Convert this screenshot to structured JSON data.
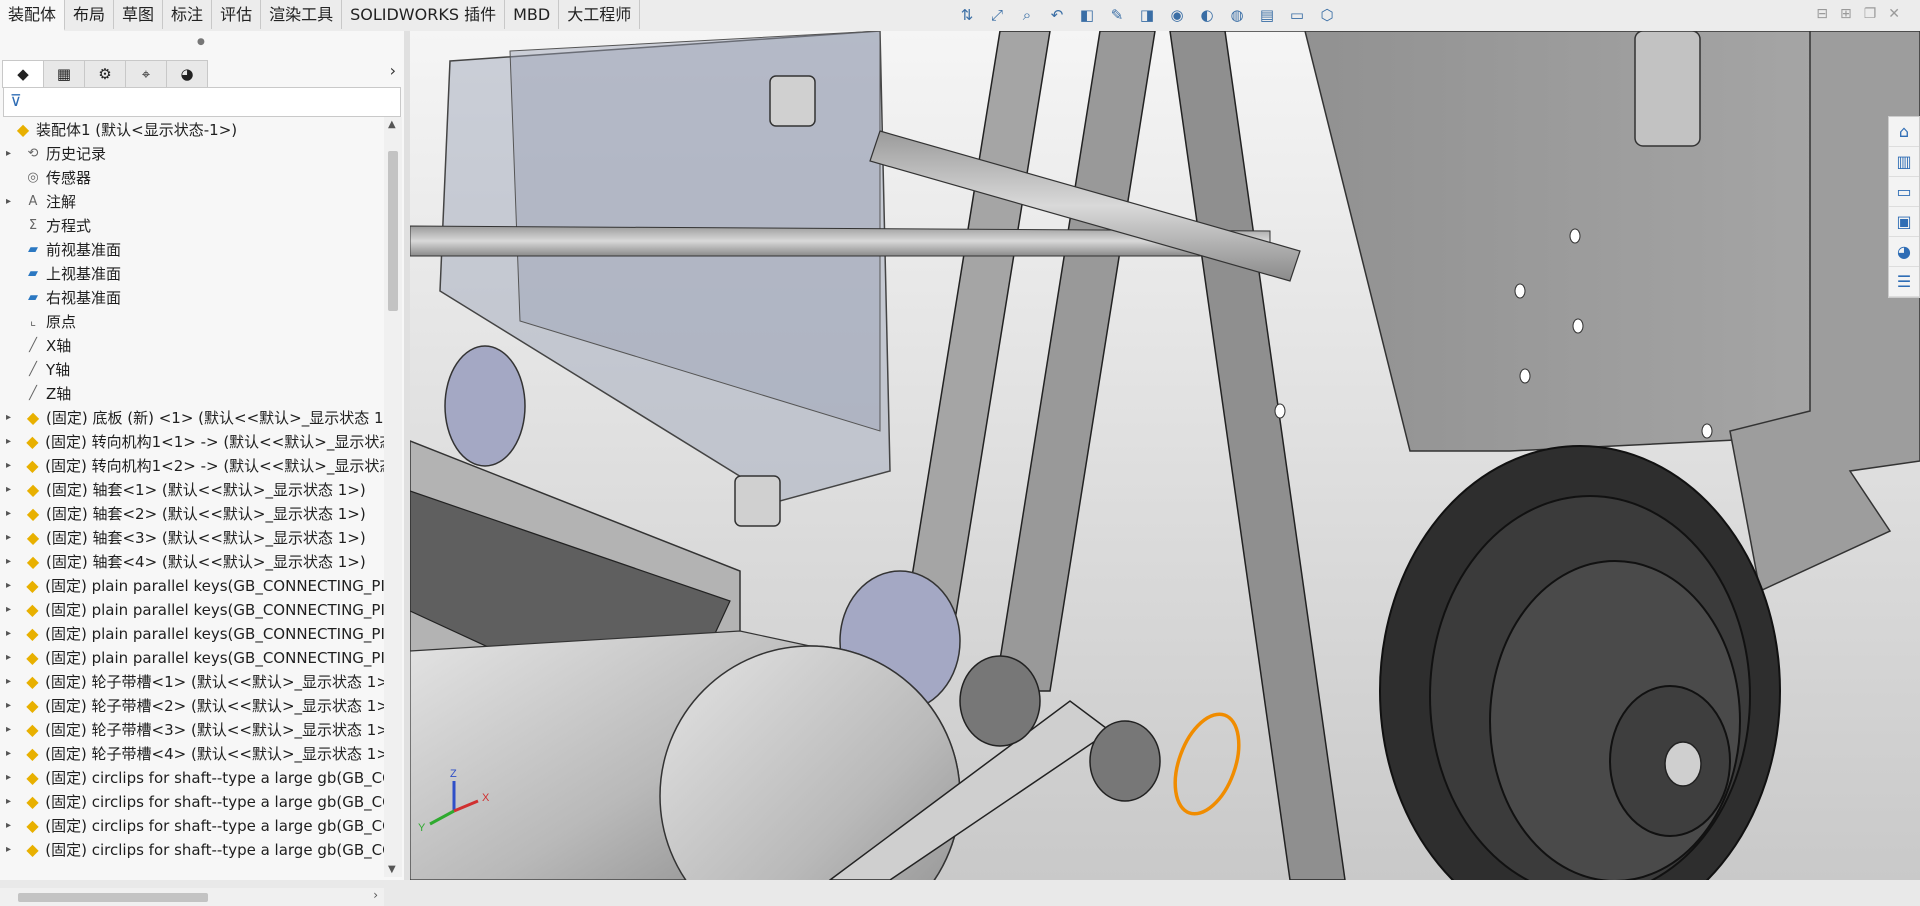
{
  "tabs": [
    {
      "label": "装配体",
      "active": true
    },
    {
      "label": "布局"
    },
    {
      "label": "草图"
    },
    {
      "label": "标注"
    },
    {
      "label": "评估"
    },
    {
      "label": "渲染工具"
    },
    {
      "label": "SOLIDWORKS 插件"
    },
    {
      "label": "MBD"
    },
    {
      "label": "大工程师"
    }
  ],
  "view_tools": [
    "view-orientation-icon",
    "zoom-to-fit-icon",
    "zoom-area-icon",
    "previous-view-icon",
    "section-view-icon",
    "dynamic-annotation-icon",
    "display-style-icon",
    "hide-show-icon",
    "edit-appearance-icon",
    "apply-scene-icon",
    "view-settings-icon",
    "display-pane-icon",
    "cube-icon"
  ],
  "panel_tabs": [
    "featuremanager-icon",
    "propertymanager-icon",
    "configurationmanager-icon",
    "dimxpert-icon",
    "displaymanager-icon"
  ],
  "tree": [
    {
      "label": "装配体1 (默认<显示状态-1>)",
      "icon": "assembly-icon",
      "arrow": false,
      "indent": 0
    },
    {
      "label": "历史记录",
      "icon": "history-icon",
      "arrow": true,
      "indent": 1
    },
    {
      "label": "传感器",
      "icon": "sensor-icon",
      "arrow": false,
      "indent": 1
    },
    {
      "label": "注解",
      "icon": "annotation-icon",
      "arrow": true,
      "indent": 1
    },
    {
      "label": "方程式",
      "icon": "equation-icon",
      "arrow": false,
      "indent": 1
    },
    {
      "label": "前视基准面",
      "icon": "plane-icon",
      "arrow": false,
      "indent": 1
    },
    {
      "label": "上视基准面",
      "icon": "plane-icon",
      "arrow": false,
      "indent": 1
    },
    {
      "label": "右视基准面",
      "icon": "plane-icon",
      "arrow": false,
      "indent": 1
    },
    {
      "label": "原点",
      "icon": "origin-icon",
      "arrow": false,
      "indent": 1
    },
    {
      "label": "X轴",
      "icon": "axis-icon",
      "arrow": false,
      "indent": 1
    },
    {
      "label": "Y轴",
      "icon": "axis-icon",
      "arrow": false,
      "indent": 1
    },
    {
      "label": "Z轴",
      "icon": "axis-icon",
      "arrow": false,
      "indent": 1
    },
    {
      "label": "(固定) 底板 (新) <1> (默认<<默认>_显示状态 1",
      "icon": "part-icon",
      "arrow": true,
      "indent": 1
    },
    {
      "label": "(固定) 转向机构1<1> -> (默认<<默认>_显示状态",
      "icon": "part-icon",
      "arrow": true,
      "indent": 1
    },
    {
      "label": "(固定) 转向机构1<2> -> (默认<<默认>_显示状态",
      "icon": "part-icon",
      "arrow": true,
      "indent": 1
    },
    {
      "label": "(固定) 轴套<1> (默认<<默认>_显示状态 1>)",
      "icon": "part-icon",
      "arrow": true,
      "indent": 1
    },
    {
      "label": "(固定) 轴套<2> (默认<<默认>_显示状态 1>)",
      "icon": "part-icon",
      "arrow": true,
      "indent": 1
    },
    {
      "label": "(固定) 轴套<3> (默认<<默认>_显示状态 1>)",
      "icon": "part-icon",
      "arrow": true,
      "indent": 1
    },
    {
      "label": "(固定) 轴套<4> (默认<<默认>_显示状态 1>)",
      "icon": "part-icon",
      "arrow": true,
      "indent": 1
    },
    {
      "label": "(固定) plain parallel keys(GB_CONNECTING_PIE",
      "icon": "part-icon",
      "arrow": true,
      "indent": 1
    },
    {
      "label": "(固定) plain parallel keys(GB_CONNECTING_PIE",
      "icon": "part-icon",
      "arrow": true,
      "indent": 1
    },
    {
      "label": "(固定) plain parallel keys(GB_CONNECTING_PIE",
      "icon": "part-icon",
      "arrow": true,
      "indent": 1
    },
    {
      "label": "(固定) plain parallel keys(GB_CONNECTING_PIE",
      "icon": "part-icon",
      "arrow": true,
      "indent": 1
    },
    {
      "label": "(固定) 轮子带槽<1> (默认<<默认>_显示状态 1>)",
      "icon": "part-icon",
      "arrow": true,
      "indent": 1
    },
    {
      "label": "(固定) 轮子带槽<2> (默认<<默认>_显示状态 1>)",
      "icon": "part-icon",
      "arrow": true,
      "indent": 1
    },
    {
      "label": "(固定) 轮子带槽<3> (默认<<默认>_显示状态 1>)",
      "icon": "part-icon",
      "arrow": true,
      "indent": 1
    },
    {
      "label": "(固定) 轮子带槽<4> (默认<<默认>_显示状态 1>)",
      "icon": "part-icon",
      "arrow": true,
      "indent": 1
    },
    {
      "label": "(固定) circlips for shaft--type a large gb(GB_CC",
      "icon": "part-icon",
      "arrow": true,
      "indent": 1
    },
    {
      "label": "(固定) circlips for shaft--type a large gb(GB_CC",
      "icon": "part-icon",
      "arrow": true,
      "indent": 1
    },
    {
      "label": "(固定) circlips for shaft--type a large gb(GB_CC",
      "icon": "part-icon",
      "arrow": true,
      "indent": 1
    },
    {
      "label": "(固定) circlips for shaft--type a large gb(GB_CC",
      "icon": "part-icon",
      "arrow": true,
      "indent": 1
    }
  ],
  "right_toolbar": [
    "solidworks-resources-icon",
    "design-library-icon",
    "file-explorer-icon",
    "view-palette-icon",
    "appearances-icon",
    "custom-properties-icon"
  ],
  "triad": {
    "x": "X",
    "y": "Y",
    "z": "Z"
  },
  "colors": {
    "highlight": "#f08c00",
    "triad_x": "#d03030",
    "triad_y": "#2faa2f",
    "triad_z": "#2f4fc8"
  }
}
